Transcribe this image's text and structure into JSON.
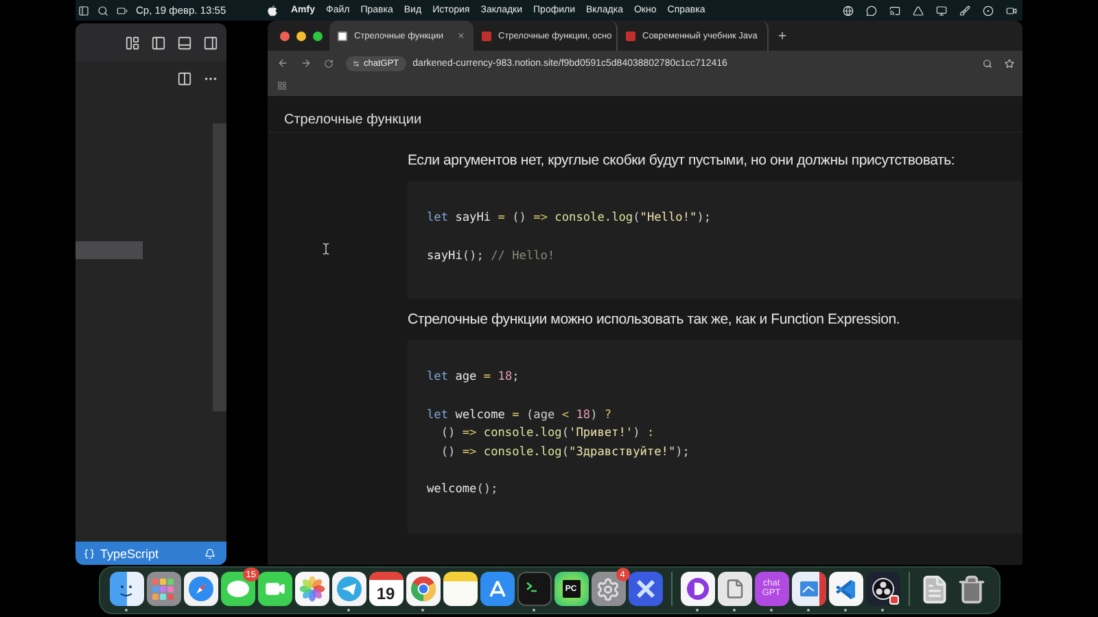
{
  "menu_bar": {
    "clock": "Ср, 19 февр. 13:55",
    "app_name": "Amfy",
    "menus": [
      "Файл",
      "Правка",
      "Вид",
      "История",
      "Закладки",
      "Профили",
      "Вкладка",
      "Окно",
      "Справка"
    ]
  },
  "editor": {
    "language": "TypeScript"
  },
  "browser": {
    "tabs": [
      {
        "title": "Стрелочные функции",
        "kind": "page",
        "selected": true
      },
      {
        "title": "Стрелочные функции, осно",
        "kind": "site",
        "selected": false
      },
      {
        "title": "Современный учебник Java",
        "kind": "site",
        "selected": false
      }
    ],
    "profile_chip": "chatGPT",
    "url": "darkened-currency-983.notion.site/f9bd0591c5d84038802780c1cc712416"
  },
  "page": {
    "title": "Стрелочные функции",
    "blocks": [
      {
        "kind": "paragraph",
        "text": "Если аргументов нет, круглые скобки будут пустыми, но они должны присутствовать:"
      },
      {
        "kind": "code",
        "groups": [
          [
            [
              {
                "kind": "keyword",
                "text": "let"
              },
              {
                "kind": "name",
                "text": " sayHi "
              },
              {
                "kind": "operator",
                "text": "="
              },
              {
                "kind": "plain",
                "text": " () "
              },
              {
                "kind": "operator",
                "text": "=>"
              },
              {
                "kind": "call",
                "text": " console.log"
              },
              {
                "kind": "plain",
                "text": "("
              },
              {
                "kind": "string",
                "text": "\"Hello!\""
              },
              {
                "kind": "plain",
                "text": ");"
              }
            ]
          ],
          [
            [
              {
                "kind": "name",
                "text": "sayHi"
              },
              {
                "kind": "plain",
                "text": "(); "
              },
              {
                "kind": "comment",
                "text": "// Hello!"
              }
            ]
          ]
        ]
      },
      {
        "kind": "paragraph",
        "text": "Стрелочные функции можно использовать так же, как и Function Expression."
      },
      {
        "kind": "code",
        "groups": [
          [
            [
              {
                "kind": "keyword",
                "text": "let"
              },
              {
                "kind": "name",
                "text": " age "
              },
              {
                "kind": "operator",
                "text": "="
              },
              {
                "kind": "number",
                "text": " 18"
              },
              {
                "kind": "plain",
                "text": ";"
              }
            ]
          ],
          [
            [
              {
                "kind": "keyword",
                "text": "let"
              },
              {
                "kind": "name",
                "text": " welcome "
              },
              {
                "kind": "operator",
                "text": "="
              },
              {
                "kind": "plain",
                "text": " (age "
              },
              {
                "kind": "operator",
                "text": "<"
              },
              {
                "kind": "number",
                "text": " 18"
              },
              {
                "kind": "plain",
                "text": ") "
              },
              {
                "kind": "operator",
                "text": "?"
              }
            ],
            [
              {
                "kind": "plain",
                "text": "  () "
              },
              {
                "kind": "operator",
                "text": "=>"
              },
              {
                "kind": "call",
                "text": " console.log"
              },
              {
                "kind": "plain",
                "text": "("
              },
              {
                "kind": "string",
                "text": "'Привет!'"
              },
              {
                "kind": "plain",
                "text": ") "
              },
              {
                "kind": "operator",
                "text": ":"
              }
            ],
            [
              {
                "kind": "plain",
                "text": "  () "
              },
              {
                "kind": "operator",
                "text": "=>"
              },
              {
                "kind": "call",
                "text": " console.log"
              },
              {
                "kind": "plain",
                "text": "("
              },
              {
                "kind": "string",
                "text": "\"Здравствуйте!\""
              },
              {
                "kind": "plain",
                "text": ");"
              }
            ]
          ],
          [
            [
              {
                "kind": "name",
                "text": "welcome"
              },
              {
                "kind": "plain",
                "text": "();"
              }
            ]
          ]
        ]
      }
    ]
  },
  "dock": [
    {
      "kind": "finder",
      "running": true
    },
    {
      "kind": "launchpad",
      "running": false
    },
    {
      "kind": "safari",
      "running": false
    },
    {
      "kind": "messages",
      "badge": "15",
      "running": false
    },
    {
      "kind": "facetime",
      "running": false
    },
    {
      "kind": "photos",
      "running": false
    },
    {
      "kind": "telegram",
      "running": true
    },
    {
      "kind": "calendar",
      "label": "19",
      "running": false
    },
    {
      "kind": "chrome",
      "running": true
    },
    {
      "kind": "notes",
      "running": false
    },
    {
      "kind": "appstore",
      "running": false
    },
    {
      "kind": "terminal",
      "running": true
    },
    {
      "kind": "pycharm",
      "label": "PC",
      "running": false
    },
    {
      "kind": "settings",
      "badge": "4",
      "running": false
    },
    {
      "kind": "xapp",
      "running": false
    },
    {
      "kind": "divider"
    },
    {
      "kind": "dapp",
      "running": true
    },
    {
      "kind": "preview",
      "running": true
    },
    {
      "kind": "chatgpt",
      "label": "chatGPT",
      "running": true
    },
    {
      "kind": "windows",
      "running": true
    },
    {
      "kind": "vscode",
      "running": true
    },
    {
      "kind": "obs",
      "running": true
    },
    {
      "kind": "divider"
    },
    {
      "kind": "document",
      "running": false
    },
    {
      "kind": "trash",
      "running": false
    }
  ]
}
